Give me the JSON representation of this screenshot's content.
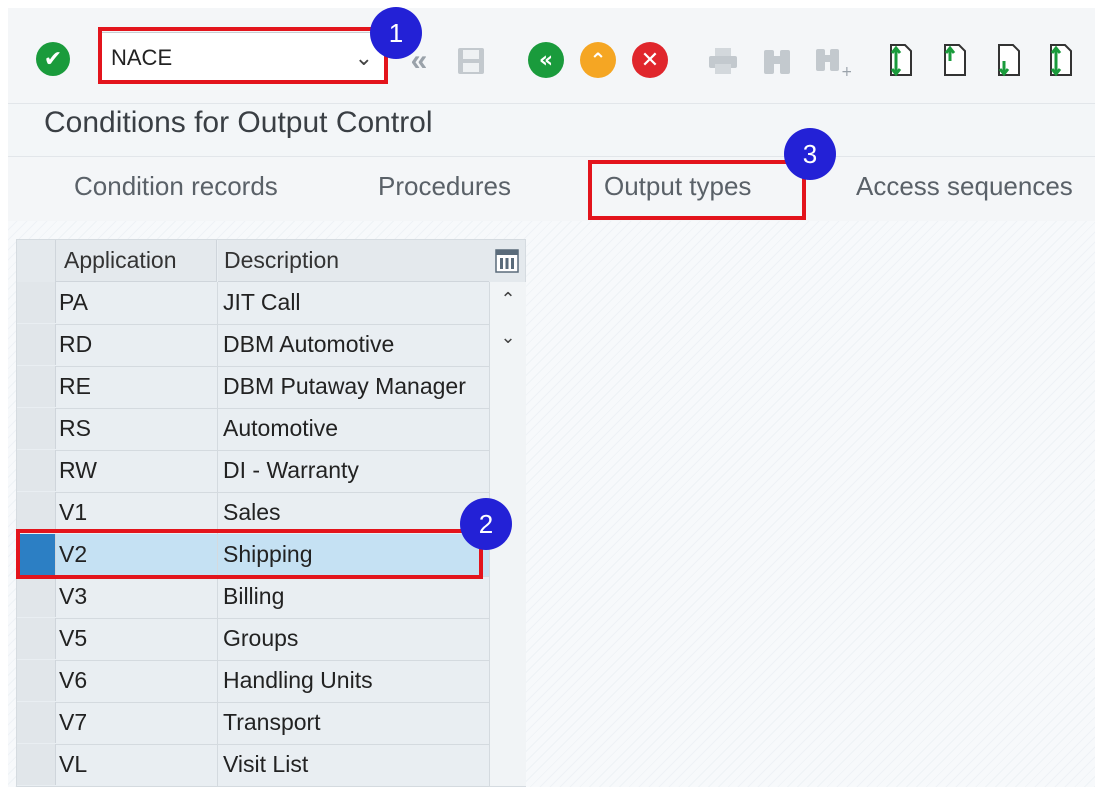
{
  "toolbar": {
    "command_value": "NACE",
    "icons": [
      "enter-check-icon",
      "back-double-icon",
      "save-icon",
      "back-icon",
      "exit-icon",
      "cancel-icon",
      "print-icon",
      "find-icon",
      "find-next-icon",
      "first-page-icon",
      "previous-page-icon",
      "next-page-icon",
      "last-page-icon"
    ]
  },
  "page": {
    "title": "Conditions for Output Control"
  },
  "tabs": [
    "Condition records",
    "Procedures",
    "Output types",
    "Access sequences"
  ],
  "table": {
    "columns": [
      "Application",
      "Description"
    ],
    "rows": [
      {
        "app": "PA",
        "desc": "JIT Call"
      },
      {
        "app": "RD",
        "desc": "DBM Automotive"
      },
      {
        "app": "RE",
        "desc": "DBM Putaway Manager"
      },
      {
        "app": "RS",
        "desc": "Automotive"
      },
      {
        "app": "RW",
        "desc": "DI - Warranty"
      },
      {
        "app": "V1",
        "desc": "Sales"
      },
      {
        "app": "V2",
        "desc": "Shipping"
      },
      {
        "app": "V3",
        "desc": "Billing"
      },
      {
        "app": "V5",
        "desc": "Groups"
      },
      {
        "app": "V6",
        "desc": "Handling Units"
      },
      {
        "app": "V7",
        "desc": "Transport"
      },
      {
        "app": "VL",
        "desc": "Visit List"
      }
    ],
    "selected_row": "V2"
  },
  "annotations": {
    "badge1": "1",
    "badge2": "2",
    "badge3": "3"
  },
  "colors": {
    "highlight": "#e3141c",
    "badge": "#2321d6",
    "selected_row": "#c5e1f3",
    "green": "#1a9b3c",
    "orange": "#f5a623",
    "red": "#e0262c"
  }
}
